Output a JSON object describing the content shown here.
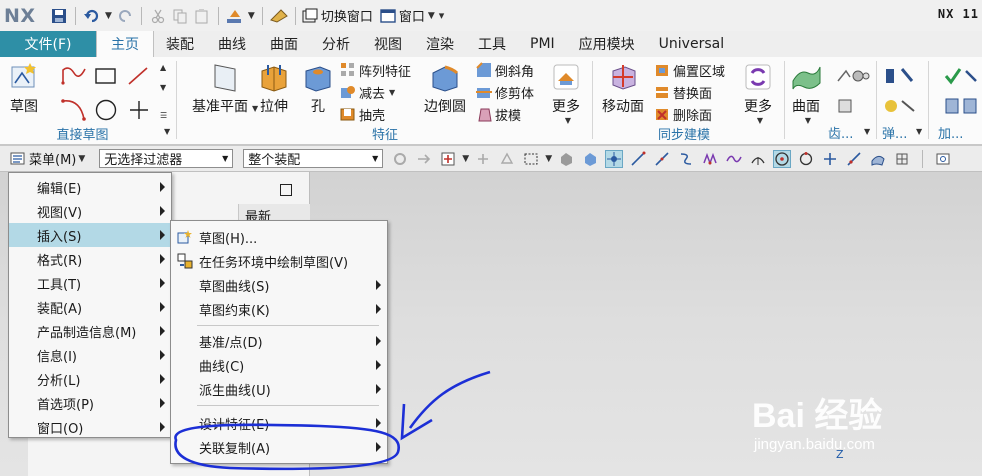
{
  "app": {
    "logo": "NX",
    "version": "NX 11",
    "qat": {
      "switch_window": "切换窗口",
      "window": "窗口"
    }
  },
  "tabs": [
    "文件(F)",
    "主页",
    "装配",
    "曲线",
    "曲面",
    "分析",
    "视图",
    "渲染",
    "工具",
    "PMI",
    "应用模块",
    "Universal"
  ],
  "ribbon": {
    "sketch_group": {
      "sketch_btn": "草图",
      "label": "直接草图"
    },
    "feature_group": {
      "datum_plane": "基准平面",
      "extrude": "拉伸",
      "hole": "孔",
      "pattern": "阵列特征",
      "subtract": "减去",
      "shell": "抽壳",
      "edge_blend": "边倒圆",
      "chamfer": "倒斜角",
      "trim_body": "修剪体",
      "draft": "拔模",
      "more": "更多",
      "label": "特征"
    },
    "sync_group": {
      "move_face": "移动面",
      "offset_region": "偏置区域",
      "replace_face": "替换面",
      "delete_face": "删除面",
      "more": "更多",
      "label": "同步建模"
    },
    "surface_group": {
      "surface": "曲面"
    },
    "truncated": {
      "gear": "齿...",
      "spring": "弹...",
      "add": "加..."
    }
  },
  "cmdbar": {
    "menu_label": "菜单(M)",
    "filter": "无选择过滤器",
    "scope": "整个装配"
  },
  "navpane": {
    "header_recent": "最新"
  },
  "menu": {
    "items": [
      "编辑(E)",
      "视图(V)",
      "插入(S)",
      "格式(R)",
      "工具(T)",
      "装配(A)",
      "产品制造信息(M)",
      "信息(I)",
      "分析(L)",
      "首选项(P)",
      "窗口(O)"
    ]
  },
  "submenu": {
    "items": [
      "草图(H)...",
      "在任务环境中绘制草图(V)",
      "草图曲线(S)",
      "草图约束(K)",
      "基准/点(D)",
      "曲线(C)",
      "派生曲线(U)",
      "设计特征(E)",
      "关联复制(A)"
    ]
  },
  "watermark": {
    "logo": "Bai 经验",
    "url": "jingyan.baidu.com"
  },
  "axis": {
    "z": "Z"
  },
  "colors": {
    "file_tab": "#2e8fa6",
    "accent_blue": "#2a73a8",
    "menu_highlight": "#b3d9e6",
    "annotation": "#1c2fd6"
  }
}
